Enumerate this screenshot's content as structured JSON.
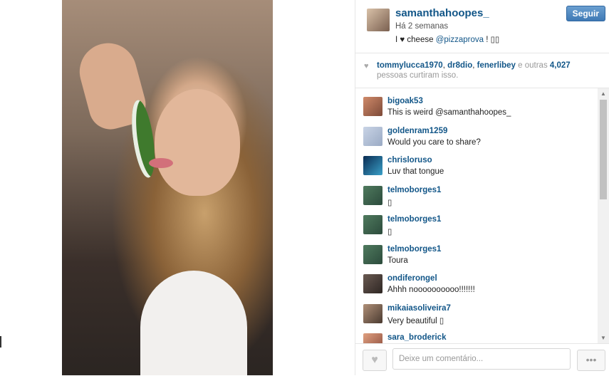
{
  "photo": {
    "alt": ""
  },
  "post": {
    "username": "samanthahoopes_",
    "time": "Há 2 semanas",
    "caption_prefix": "I ♥ cheese ",
    "caption_mention": "@pizzaprova",
    "caption_suffix": " ! ▯▯",
    "follow_label": "Seguir"
  },
  "likes": {
    "users": [
      "tommylucca1970",
      "dr8dio",
      "fenerlibey"
    ],
    "sep1": ", ",
    "sep2": ", ",
    "others_text": " e outras ",
    "count": "4,027",
    "line2": "pessoas curtiram isso."
  },
  "comments": [
    {
      "user": "bigoak53",
      "text": "This is weird @samanthahoopes_"
    },
    {
      "user": "goldenram1259",
      "text": "Would you care to share?"
    },
    {
      "user": "chrisloruso",
      "text": "Luv that tongue"
    },
    {
      "user": "telmoborges1",
      "text": "▯"
    },
    {
      "user": "telmoborges1",
      "text": "▯"
    },
    {
      "user": "telmoborges1",
      "text": "Toura"
    },
    {
      "user": "ondiferongel",
      "text": "Ahhh noooooooooo!!!!!!!"
    },
    {
      "user": "mikaiasoliveira7",
      "text": "Very beautiful ▯"
    },
    {
      "user": "sara_broderick",
      "text": ""
    }
  ],
  "footer": {
    "like_icon": "♥",
    "comment_placeholder": "Deixe um comentário...",
    "more_icon": "•••"
  },
  "colors": {
    "link": "#125688",
    "follow_button": "#3f79b5"
  }
}
